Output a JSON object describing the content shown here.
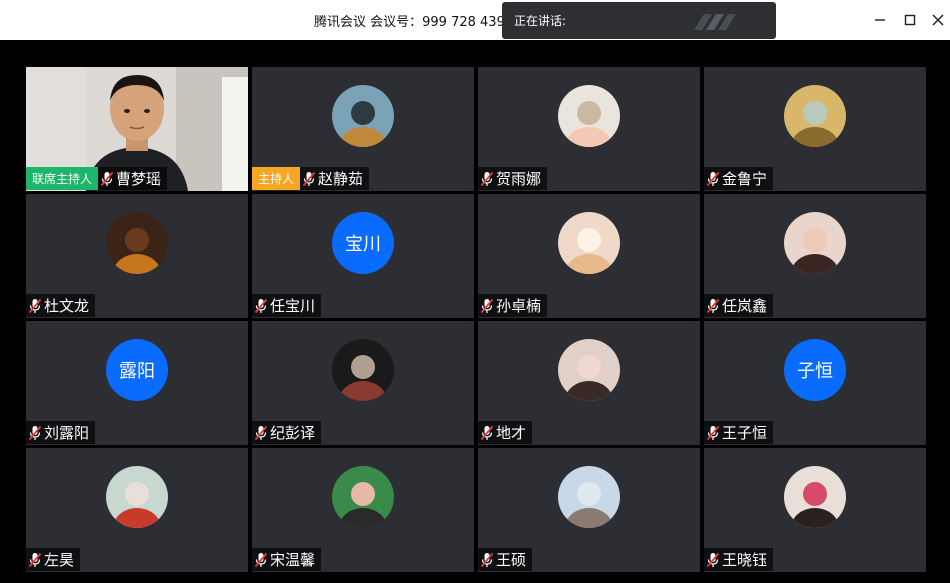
{
  "window": {
    "title": "腾讯会议  会议号：999 728 439",
    "speaking_label": "正在讲话:",
    "icons": [
      "minimize-icon",
      "maximize-icon",
      "close-icon"
    ]
  },
  "participants": [
    {
      "name": "曹梦瑶",
      "badge": "联席主持人",
      "type": "video"
    },
    {
      "name": "赵静茹",
      "badge": "主持人",
      "type": "photo",
      "palette": [
        "#7aa3b8",
        "#c08a3a",
        "#2d3a40"
      ]
    },
    {
      "name": "贺雨娜",
      "badge": "",
      "type": "photo",
      "palette": [
        "#e9e4dc",
        "#f3c9b5",
        "#c9b9a2"
      ]
    },
    {
      "name": "金鲁宁",
      "badge": "",
      "type": "photo",
      "palette": [
        "#d9b76a",
        "#8a6a2d",
        "#b8c9c0"
      ]
    },
    {
      "name": "杜文龙",
      "badge": "",
      "type": "photo",
      "palette": [
        "#3a2418",
        "#c8761e",
        "#6b3a1d"
      ]
    },
    {
      "name": "任宝川",
      "badge": "",
      "type": "initials",
      "initials": "宝川"
    },
    {
      "name": "孙卓楠",
      "badge": "",
      "type": "photo",
      "palette": [
        "#f0d9c8",
        "#e8b98a",
        "#fff3e8"
      ]
    },
    {
      "name": "任岚鑫",
      "badge": "",
      "type": "photo",
      "palette": [
        "#e8d5cc",
        "#3a2520",
        "#f0c8b8"
      ]
    },
    {
      "name": "刘露阳",
      "badge": "",
      "type": "initials",
      "initials": "露阳"
    },
    {
      "name": "纪彭译",
      "badge": "",
      "type": "photo",
      "palette": [
        "#1a1a1a",
        "#8a3a30",
        "#b0a090"
      ]
    },
    {
      "name": "地才",
      "badge": "",
      "type": "photo",
      "palette": [
        "#e0d0c8",
        "#3a2a25",
        "#f0d8d0"
      ]
    },
    {
      "name": "王子恒",
      "badge": "",
      "type": "initials",
      "initials": "子恒"
    },
    {
      "name": "左昊",
      "badge": "",
      "type": "photo",
      "palette": [
        "#c8d8d0",
        "#c83a2a",
        "#e8e0d8"
      ]
    },
    {
      "name": "宋温馨",
      "badge": "",
      "type": "photo",
      "palette": [
        "#3a8a4a",
        "#2a2a2a",
        "#e8b8a8"
      ]
    },
    {
      "name": "王硕",
      "badge": "",
      "type": "photo",
      "palette": [
        "#c8d8e8",
        "#8a7a70",
        "#e0e8f0"
      ]
    },
    {
      "name": "王晓钰",
      "badge": "",
      "type": "photo",
      "palette": [
        "#e8e0d8",
        "#2a2020",
        "#d84a6a"
      ]
    }
  ]
}
